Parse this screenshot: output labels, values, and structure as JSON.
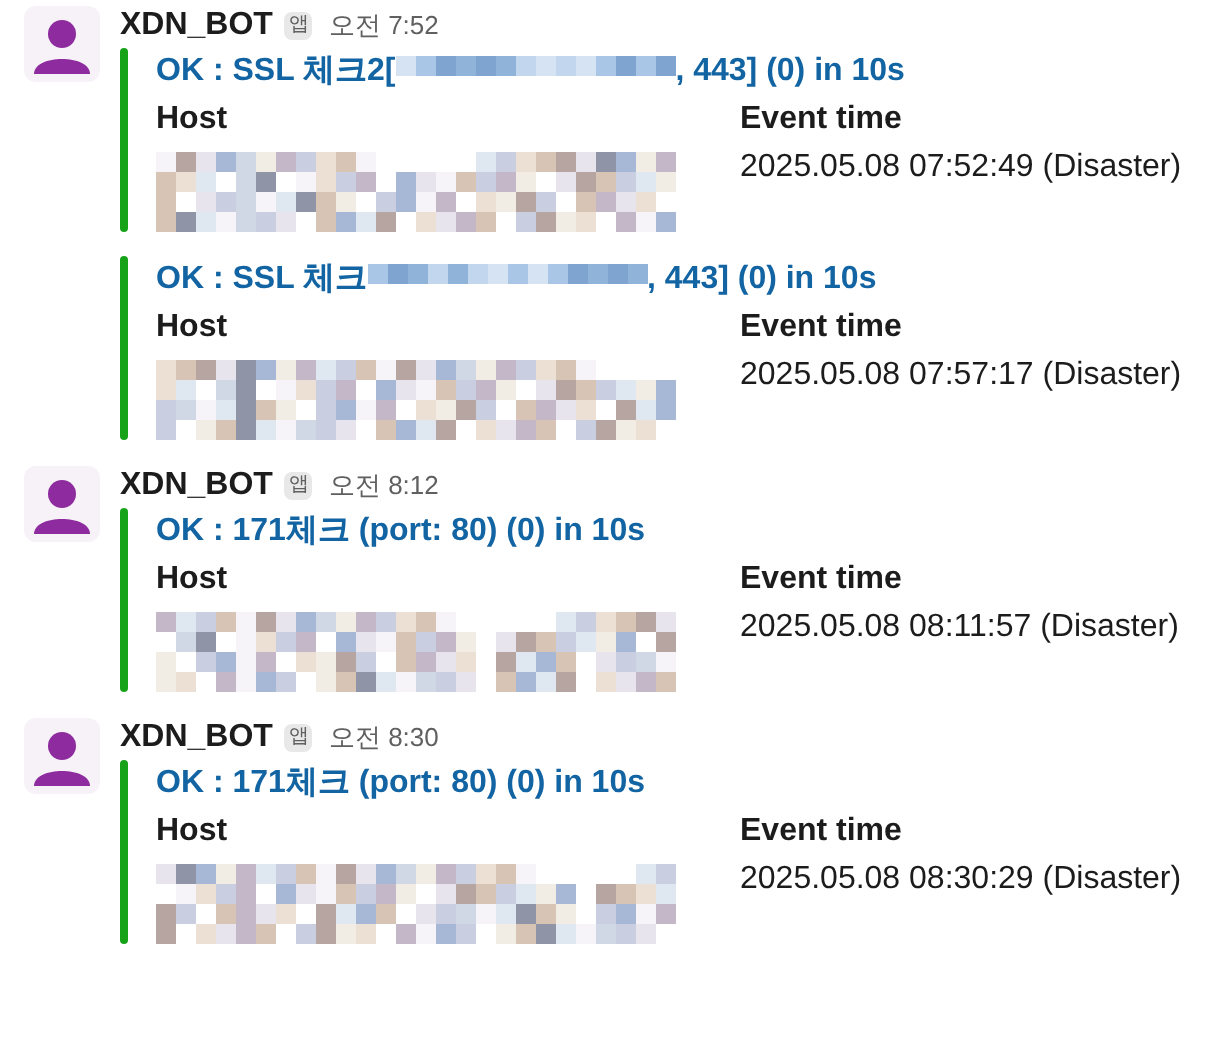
{
  "messages": [
    {
      "sender": "XDN_BOT",
      "badge": "앱",
      "time": "오전 7:52",
      "attachments": [
        {
          "title": [
            {
              "kind": "text",
              "text": "OK : SSL 체크2["
            },
            {
              "kind": "redacted"
            },
            {
              "kind": "text",
              "text": ", 443] (0) in 10s"
            }
          ],
          "fields": [
            {
              "label": "Host",
              "kind": "redacted"
            },
            {
              "label": "Event time",
              "kind": "text",
              "value": "2025.05.08 07:52:49 (Disaster)"
            }
          ]
        },
        {
          "title": [
            {
              "kind": "text",
              "text": "OK : SSL 체크"
            },
            {
              "kind": "redacted"
            },
            {
              "kind": "text",
              "text": ", 443] (0) in 10s"
            }
          ],
          "fields": [
            {
              "label": "Host",
              "kind": "redacted"
            },
            {
              "label": "Event time",
              "kind": "text",
              "value": "2025.05.08 07:57:17 (Disaster)"
            }
          ]
        }
      ]
    },
    {
      "sender": "XDN_BOT",
      "badge": "앱",
      "time": "오전 8:12",
      "attachments": [
        {
          "title": [
            {
              "kind": "text",
              "text": "OK : 171체크 (port: 80) (0) in 10s"
            }
          ],
          "fields": [
            {
              "label": "Host",
              "kind": "redacted"
            },
            {
              "label": "Event time",
              "kind": "text",
              "value": "2025.05.08 08:11:57 (Disaster)"
            }
          ]
        }
      ]
    },
    {
      "sender": "XDN_BOT",
      "badge": "앱",
      "time": "오전 8:30",
      "attachments": [
        {
          "title": [
            {
              "kind": "text",
              "text": "OK : 171체크 (port: 80) (0) in 10s"
            }
          ],
          "fields": [
            {
              "label": "Host",
              "kind": "redacted"
            },
            {
              "label": "Event time",
              "kind": "text",
              "value": "2025.05.08 08:30:29 (Disaster)"
            }
          ]
        }
      ]
    }
  ]
}
